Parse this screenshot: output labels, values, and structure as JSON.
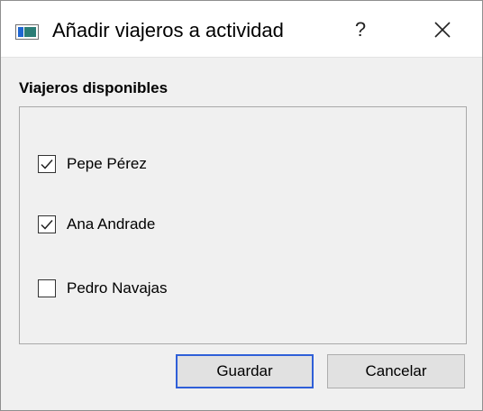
{
  "dialog": {
    "title": "Añadir viajeros a actividad",
    "help_label": "?"
  },
  "section": {
    "label": "Viajeros disponibles"
  },
  "travelers": [
    {
      "name": "Pepe Pérez",
      "checked": true
    },
    {
      "name": "Ana Andrade",
      "checked": true
    },
    {
      "name": "Pedro Navajas",
      "checked": false
    }
  ],
  "buttons": {
    "save_label": "Guardar",
    "cancel_label": "Cancelar"
  }
}
